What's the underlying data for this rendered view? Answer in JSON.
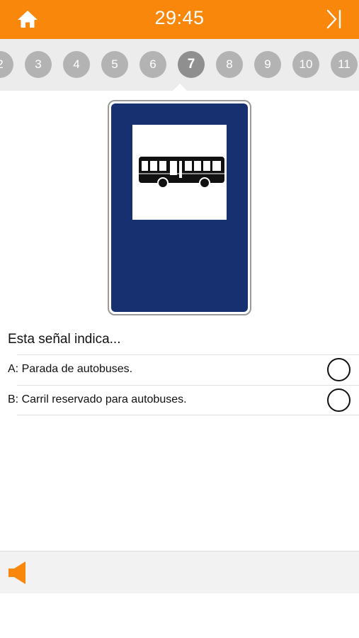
{
  "header": {
    "timer": "29:45",
    "home_icon": "home-icon",
    "skip_icon": "skip-to-end-icon",
    "background": "#f9870c"
  },
  "question_nav": {
    "items": [
      "2",
      "3",
      "4",
      "5",
      "6",
      "7",
      "8",
      "9",
      "10",
      "11"
    ],
    "current": "7"
  },
  "sign": {
    "icon": "bus-stop-sign",
    "border_color": "#17306f",
    "background": "#ffffff"
  },
  "question": {
    "text": "Esta señal indica..."
  },
  "options": [
    {
      "label": "A: Parada de autobuses."
    },
    {
      "label": "B: Carril reservado para autobuses."
    }
  ],
  "footer": {
    "speaker_icon": "speaker-icon",
    "accent": "#f9870c"
  }
}
